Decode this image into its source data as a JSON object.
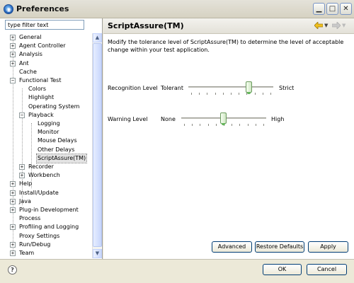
{
  "window": {
    "title": "Preferences",
    "controls": {
      "minimize": "▁",
      "maximize": "□",
      "close": "✕"
    },
    "icon": "eclipse-app-icon"
  },
  "filter": {
    "value": "type filter text"
  },
  "tree": [
    {
      "label": "General",
      "depth": 0,
      "expander": "+"
    },
    {
      "label": "Agent Controller",
      "depth": 0,
      "expander": "+"
    },
    {
      "label": "Analysis",
      "depth": 0,
      "expander": "+"
    },
    {
      "label": "Ant",
      "depth": 0,
      "expander": "+"
    },
    {
      "label": "Cache",
      "depth": 0,
      "expander": ""
    },
    {
      "label": "Functional Test",
      "depth": 0,
      "expander": "−"
    },
    {
      "label": "Colors",
      "depth": 1,
      "expander": ""
    },
    {
      "label": "Highlight",
      "depth": 1,
      "expander": ""
    },
    {
      "label": "Operating System",
      "depth": 1,
      "expander": ""
    },
    {
      "label": "Playback",
      "depth": 1,
      "expander": "−"
    },
    {
      "label": "Logging",
      "depth": 2,
      "expander": ""
    },
    {
      "label": "Monitor",
      "depth": 2,
      "expander": ""
    },
    {
      "label": "Mouse Delays",
      "depth": 2,
      "expander": ""
    },
    {
      "label": "Other Delays",
      "depth": 2,
      "expander": ""
    },
    {
      "label": "ScriptAssure(TM)",
      "depth": 2,
      "expander": "",
      "selected": true
    },
    {
      "label": "Recorder",
      "depth": 1,
      "expander": "+"
    },
    {
      "label": "Workbench",
      "depth": 1,
      "expander": "+"
    },
    {
      "label": "Help",
      "depth": 0,
      "expander": "+"
    },
    {
      "label": "Install/Update",
      "depth": 0,
      "expander": "+"
    },
    {
      "label": "Java",
      "depth": 0,
      "expander": "+"
    },
    {
      "label": "Plug-in Development",
      "depth": 0,
      "expander": "+"
    },
    {
      "label": "Process",
      "depth": 0,
      "expander": ""
    },
    {
      "label": "Profiling and Logging",
      "depth": 0,
      "expander": "+"
    },
    {
      "label": "Proxy Settings",
      "depth": 0,
      "expander": ""
    },
    {
      "label": "Run/Debug",
      "depth": 0,
      "expander": "+"
    },
    {
      "label": "Team",
      "depth": 0,
      "expander": "+"
    }
  ],
  "page": {
    "title": "ScriptAssure(TM)",
    "description": "Modify the tolerance level of ScriptAssure(TM) to determine the level of acceptable change within your test application.",
    "recognition": {
      "label": "Recognition Level",
      "min_label": "Tolerant",
      "max_label": "Strict",
      "level": 0.73,
      "ticks": 11
    },
    "warning": {
      "label": "Warning Level",
      "min_label": "None",
      "max_label": "High",
      "level": 0.5,
      "ticks": 11
    }
  },
  "buttons": {
    "advanced": "Advanced",
    "restore_defaults": "Restore Defaults",
    "apply": "Apply",
    "ok": "OK",
    "cancel": "Cancel"
  },
  "icons": {
    "help": "?",
    "nav_back_color": "#f2c01c",
    "nav_forward_color": "#c9c9c9"
  }
}
